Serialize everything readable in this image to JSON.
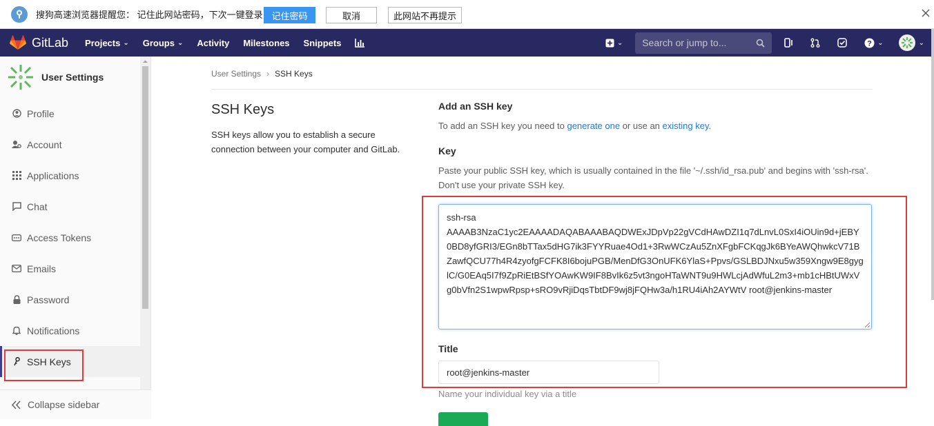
{
  "browser_prompt": {
    "message": "搜狗高速浏览器提醒您：  记住此网站密码，下次一键登录！",
    "remember_label": "记住密码",
    "cancel_label": "取消",
    "never_label": "此网站不再提示"
  },
  "navbar": {
    "brand": "GitLab",
    "links": [
      {
        "label": "Projects",
        "dropdown": true
      },
      {
        "label": "Groups",
        "dropdown": true
      },
      {
        "label": "Activity",
        "dropdown": false
      },
      {
        "label": "Milestones",
        "dropdown": false
      },
      {
        "label": "Snippets",
        "dropdown": false
      }
    ],
    "search_placeholder": "Search or jump to..."
  },
  "sidebar": {
    "title": "User Settings",
    "items": [
      {
        "label": "Profile",
        "icon": "profile-icon",
        "active": false
      },
      {
        "label": "Account",
        "icon": "account-icon",
        "active": false
      },
      {
        "label": "Applications",
        "icon": "applications-icon",
        "active": false
      },
      {
        "label": "Chat",
        "icon": "chat-icon",
        "active": false
      },
      {
        "label": "Access Tokens",
        "icon": "access-tokens-icon",
        "active": false
      },
      {
        "label": "Emails",
        "icon": "emails-icon",
        "active": false
      },
      {
        "label": "Password",
        "icon": "lock-icon",
        "active": false
      },
      {
        "label": "Notifications",
        "icon": "bell-icon",
        "active": false
      },
      {
        "label": "SSH Keys",
        "icon": "key-icon",
        "active": true
      }
    ],
    "collapse_label": "Collapse sidebar"
  },
  "breadcrumb": {
    "parent": "User Settings",
    "current": "SSH Keys"
  },
  "intro": {
    "title": "SSH Keys",
    "description": "SSH keys allow you to establish a secure connection between your computer and GitLab."
  },
  "form": {
    "heading": "Add an SSH key",
    "help_prefix": "To add an SSH key you need to ",
    "help_link1": "generate one",
    "help_middle": " or use an ",
    "help_link2": "existing key",
    "help_suffix": ".",
    "key_label": "Key",
    "key_help": "Paste your public SSH key, which is usually contained in the file '~/.ssh/id_rsa.pub' and begins with 'ssh-rsa'. Don't use your private SSH key.",
    "key_line1": "ssh-rsa",
    "key_value": "AAAAB3NzaC1yc2EAAAADAQABAAABAQDWExJDpVp22gVCdHAwDZI1q7dLnvL0SxI4iOUin9d+jEBY0BD8yfGRI3/EGn8bTTax5dHG7ik3FYYRuae4Od1+3RwWCzAu5ZnXFgbFCKqgJk6BYeAWQhwkcV71BZawfQCU77h4R4zyofgFCFK8I6bojuPGB/MenDfG3OnUFK6YlaS+Ppvs/GSLBDJNxu5w359Xngw9E8gyglC/G0EAq5I7f9ZpRiEtBSfYOAwKW9IF8BvIk6z5vt3ngoHTaWNT9u9HWLcjAdWfuL2m3+mb1cHBtUWxVg0bVfn2S1wpwRpsp+sRO9vRjiDqsTbtDF9wj8jFQHw3a/h1RU4iAh2AYWtV root@jenkins-master",
    "title_label": "Title",
    "title_value": "root@jenkins-master",
    "title_hint": "Name your individual key via a title"
  },
  "colors": {
    "navbar": "#292961",
    "accent_link": "#1f78d1",
    "annotation_red": "#e03a3a",
    "add_button": "#1aaa55"
  }
}
